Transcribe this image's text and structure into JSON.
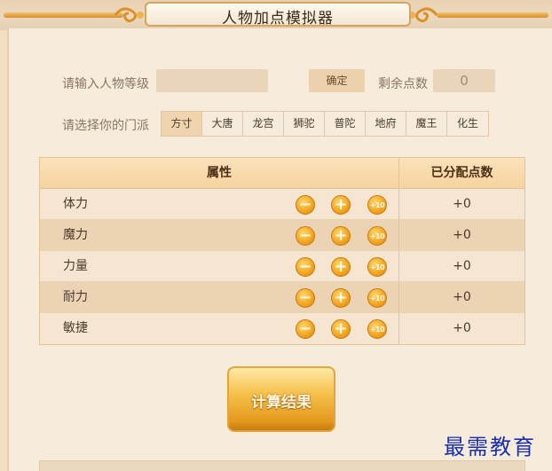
{
  "title": "人物加点模拟器",
  "level": {
    "label": "请输入人物等级",
    "value": "",
    "confirm_label": "确定",
    "remaining_label": "剩余点数",
    "remaining_value": "0"
  },
  "sect": {
    "label": "请选择你的门派",
    "options": [
      "方寸",
      "大唐",
      "龙宫",
      "狮驼",
      "普陀",
      "地府",
      "魔王",
      "化生"
    ],
    "selected": "方寸"
  },
  "table": {
    "col_attr": "属性",
    "col_points": "已分配点数",
    "rows": [
      {
        "name": "体力",
        "points": "+0"
      },
      {
        "name": "魔力",
        "points": "+0"
      },
      {
        "name": "力量",
        "points": "+0"
      },
      {
        "name": "耐力",
        "points": "+0"
      },
      {
        "name": "敏捷",
        "points": "+0"
      }
    ],
    "minus_symbol": "−",
    "plus_symbol": "+",
    "plus10_symbol": "+10"
  },
  "calc_label": "计算结果",
  "watermark": "最需教育",
  "colors": {
    "accent": "#f2a31e",
    "background": "#f7ecdc",
    "watermark": "#1a2fb0"
  }
}
